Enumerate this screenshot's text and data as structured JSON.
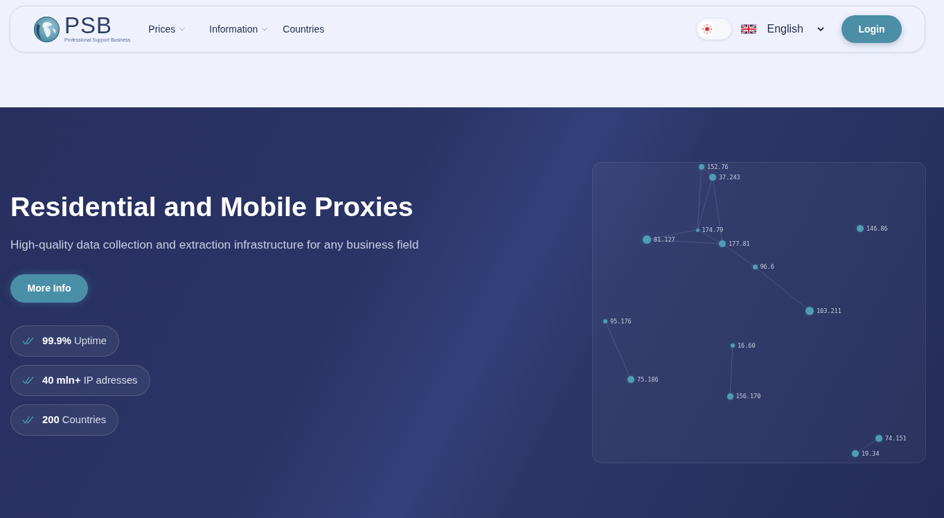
{
  "header": {
    "logo": {
      "name": "PSB",
      "tagline": "Professional Support Business"
    },
    "nav": [
      {
        "label": "Prices",
        "kind": "dropdown"
      },
      {
        "label": "Information",
        "kind": "dropdown"
      },
      {
        "label": "Countries",
        "kind": "link"
      }
    ],
    "theme_toggle": {
      "on": false
    },
    "language": {
      "label": "English"
    },
    "login": "Login"
  },
  "hero": {
    "title": "Residential and Mobile Proxies",
    "subtitle": "High-quality data collection and extraction infrastructure for any business field",
    "button": "More Info",
    "features": [
      "**99.9%** Uptime",
      "**40 mln+** IP adresses",
      "**200** Countries"
    ],
    "network": {
      "nodes": [
        "152.76",
        "37.243",
        "174.79",
        "81.127",
        "177.81",
        "96.6",
        "146.86",
        "103.211",
        "95.176",
        "16.60",
        "75.186",
        "156.170",
        "74.151",
        "19.34"
      ]
    }
  }
}
